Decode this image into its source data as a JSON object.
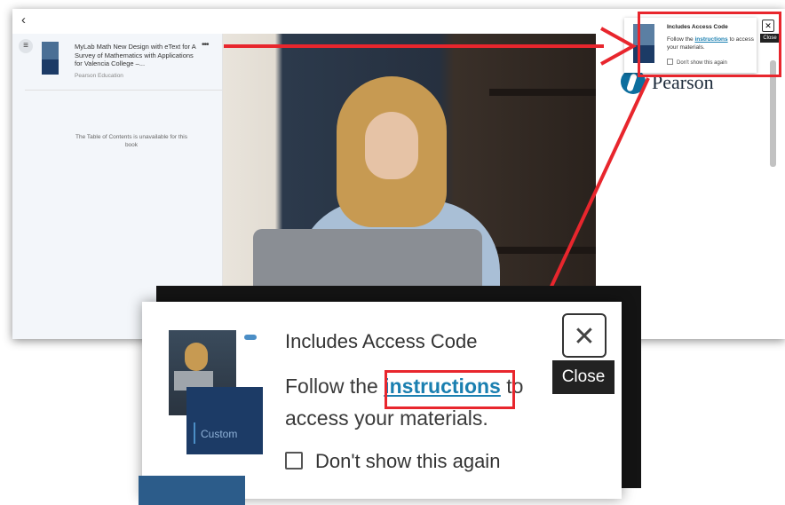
{
  "colors": {
    "annotation_red": "#e8262d",
    "link_blue": "#1a7fb0",
    "brand_navy": "#1c3b66"
  },
  "topbar": {
    "back_icon": "‹"
  },
  "sidebar": {
    "menu_icon": "≡",
    "book_title": "MyLab Math New Design with eText for A Survey of Mathematics with Applications for Valencia College –...",
    "publisher": "Pearson Education",
    "more_icon": "•••",
    "toc_message": "The Table of Contents is unavailable for this book"
  },
  "brand": {
    "logo_text": "Pearson"
  },
  "mini_popup": {
    "title": "Includes Access Code",
    "follow_prefix": "Follow the ",
    "link": "instructions",
    "follow_suffix": " to access your materials.",
    "checkbox_label": "Don't show this again",
    "close_icon": "✕",
    "close_tooltip": "Close"
  },
  "popup": {
    "title": "Includes Access Code",
    "follow_prefix": "Follow the ",
    "link": "instructions",
    "follow_suffix": " to access your materials.",
    "checkbox_label": "Don't show this again",
    "cover_label": "Custom",
    "close_icon": "✕",
    "close_tooltip": "Close"
  }
}
